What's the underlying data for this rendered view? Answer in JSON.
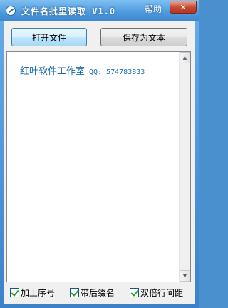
{
  "window": {
    "title": "文件名批里读取 V1.0",
    "help_label": "帮助",
    "close_label": "✕"
  },
  "toolbar": {
    "open_label": "打开文件",
    "save_label": "保存为文本"
  },
  "content": {
    "studio_name": "红叶软件工作室",
    "qq_text": "QQ: 574783833"
  },
  "scrollbar": {
    "up_arrow": "▲",
    "down_arrow": "▼"
  },
  "options": [
    {
      "label": "加上序号",
      "checked": true
    },
    {
      "label": "带后缀名",
      "checked": true
    },
    {
      "label": "双倍行间距",
      "checked": true
    }
  ]
}
